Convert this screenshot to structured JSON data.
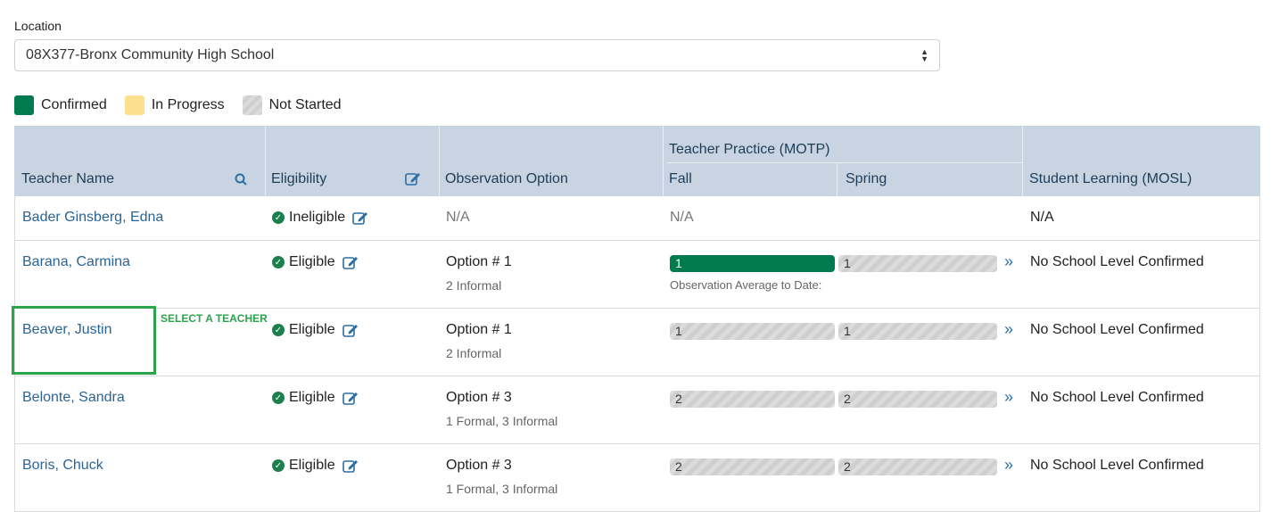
{
  "location": {
    "label": "Location",
    "selected": "08X377-Bronx Community High School"
  },
  "legend": [
    {
      "label": "Confirmed",
      "color": "#027a4f"
    },
    {
      "label": "In Progress",
      "color": "#fde08f"
    },
    {
      "label": "Not Started",
      "color": "#d3d3d3"
    }
  ],
  "header": {
    "teacher_name": "Teacher Name",
    "eligibility": "Eligibility",
    "observation_option": "Observation Option",
    "teacher_practice": "Teacher Practice (MOTP)",
    "fall": "Fall",
    "spring": "Spring",
    "student_learning": "Student Learning (MOSL)"
  },
  "rows": [
    {
      "name": "Bader Ginsberg, Edna",
      "eligibility": "Ineligible",
      "option": "N/A",
      "fall": "N/A",
      "mosl": "N/A"
    },
    {
      "name": "Barana, Carmina",
      "eligibility": "Eligible",
      "option": "Option # 1",
      "option_detail": "2 Informal",
      "fall_value": "1",
      "fall_status": "confirmed",
      "spring_value": "1",
      "spring_status": "not-started",
      "avg_note": "Observation Average to Date:",
      "mosl": "No School Level Confirmed"
    },
    {
      "name": "Beaver, Justin",
      "eligibility": "Eligible",
      "option": "Option # 1",
      "option_detail": "2 Informal",
      "fall_value": "1",
      "fall_status": "not-started",
      "spring_value": "1",
      "spring_status": "not-started",
      "mosl": "No School Level Confirmed"
    },
    {
      "name": "Belonte, Sandra",
      "eligibility": "Eligible",
      "option": "Option # 3",
      "option_detail": "1 Formal, 3 Informal",
      "fall_value": "2",
      "fall_status": "not-started",
      "spring_value": "2",
      "spring_status": "not-started",
      "mosl": "No School Level Confirmed"
    },
    {
      "name": "Boris, Chuck",
      "eligibility": "Eligible",
      "option": "Option # 3",
      "option_detail": "1 Formal, 3 Informal",
      "fall_value": "2",
      "fall_status": "not-started",
      "spring_value": "2",
      "spring_status": "not-started",
      "mosl": "No School Level Confirmed"
    }
  ],
  "annotation": {
    "text": "SELECT A TEACHER",
    "color": "#2ca44c"
  }
}
